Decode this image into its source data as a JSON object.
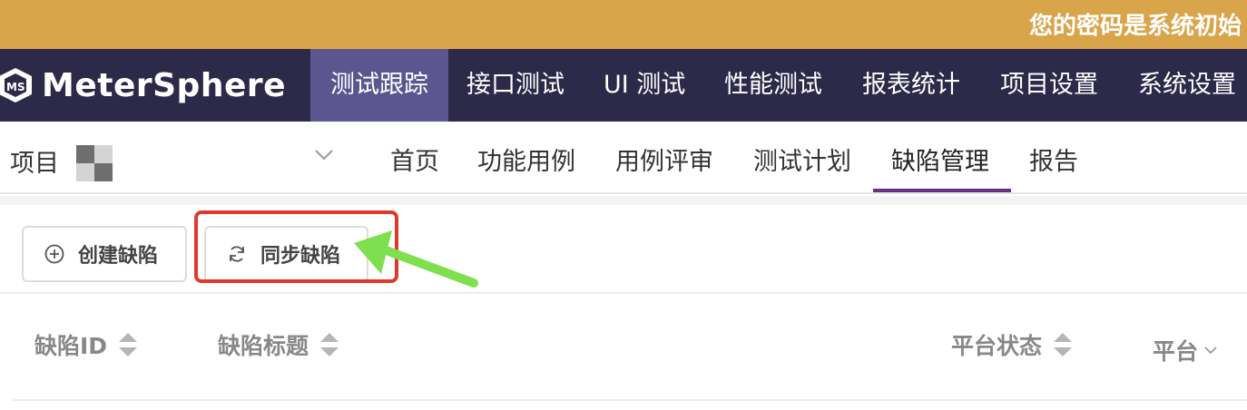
{
  "banner": {
    "text": "您的密码是系统初始"
  },
  "brand": {
    "name": "MeterSphere"
  },
  "topnav": {
    "items": [
      {
        "label": "测试跟踪",
        "active": true
      },
      {
        "label": "接口测试"
      },
      {
        "label": "UI 测试"
      },
      {
        "label": "性能测试"
      },
      {
        "label": "报表统计"
      },
      {
        "label": "项目设置"
      },
      {
        "label": "系统设置"
      }
    ]
  },
  "subnav": {
    "project_label": "项目",
    "dropdown_icon": "chevron-down-icon",
    "items": [
      {
        "label": "首页"
      },
      {
        "label": "功能用例"
      },
      {
        "label": "用例评审"
      },
      {
        "label": "测试计划"
      },
      {
        "label": "缺陷管理",
        "active": true
      },
      {
        "label": "报告"
      }
    ]
  },
  "toolbar": {
    "create_label": "创建缺陷",
    "create_icon": "plus-circle-icon",
    "sync_label": "同步缺陷",
    "sync_icon": "refresh-icon"
  },
  "annotation": {
    "highlight_color": "#e0392b",
    "arrow_color": "#7ee04f"
  },
  "table": {
    "columns": [
      {
        "label": "缺陷ID",
        "sortable": true
      },
      {
        "label": "缺陷标题",
        "sortable": true
      },
      {
        "label": "平台状态",
        "sortable": true
      },
      {
        "label": "平台",
        "filter": true
      }
    ]
  },
  "colors": {
    "banner": "#d9a54b",
    "topnav": "#2c2a48",
    "topnav_active": "#5b568f",
    "accent": "#6a2f88"
  }
}
